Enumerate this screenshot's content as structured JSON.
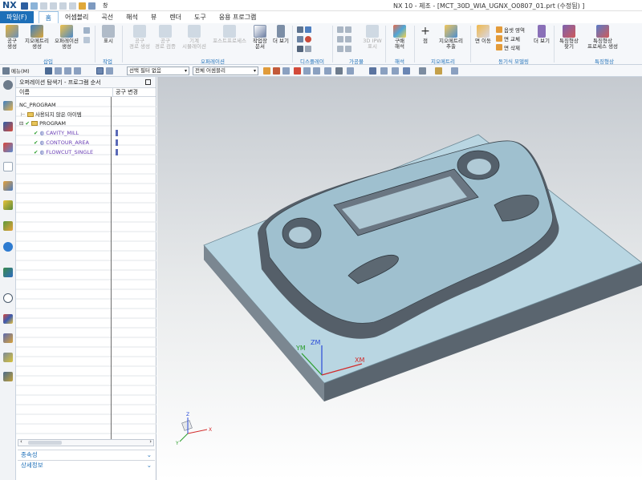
{
  "titlebar": {
    "logo": "NX",
    "title": "NX 10 - 제조 - [MCT_30D_WIA_UGNX_O0807_01.prt (수정됨) ]",
    "window_menu": "창"
  },
  "menubar": {
    "file": "파일(F)",
    "items": [
      "홈",
      "어셈블리",
      "곡선",
      "해석",
      "뷰",
      "렌더",
      "도구",
      "응용 프로그램"
    ],
    "active_index": 0
  },
  "ribbon": {
    "buttons": {
      "tool_create": "공구\n생성",
      "geometry_create": "지오메트리\n생성",
      "operation_create": "오퍼레이션\n생성",
      "display": "표시",
      "toolpath_create": "공구\n경로 생성",
      "toolpath_verify": "공구\n경로 검증",
      "machine_sim": "기계\n시뮬레이션",
      "postprocess": "포스트프로세스",
      "shop_doc": "작업장\n문서",
      "more1": "더 보기",
      "fea3d": "3D IPW\n표시",
      "measure": "구배\n해석",
      "point": "점",
      "geo_extract": "지오메트리\n추출",
      "face_move": "면 이동",
      "offset_area": "옵셋 영역",
      "face_replace": "면 교체",
      "face_delete": "면 삭제",
      "more2": "더 보기",
      "feature_find": "특징형상\n찾기",
      "feature_process": "특징형상\n프로세스 생성"
    },
    "groups": [
      "삽입",
      "작업",
      "오퍼레이션",
      "디스플레이",
      "가공물",
      "해석",
      "지오메트리",
      "동기식 모델링",
      "특징형상"
    ]
  },
  "toolbar2": {
    "menu_label": "메뉴(M)",
    "filter_value": "선택 필터 없음",
    "assembly_value": "전체 어셈블리"
  },
  "navigator": {
    "title": "오퍼레이션 탐색기 - 프로그램 순서",
    "col_name": "이름",
    "col_toolchange": "공구 변경",
    "rows": [
      {
        "label": "NC_PROGRAM",
        "level": 0,
        "type": "root"
      },
      {
        "label": "사용되지 않은 아이템",
        "level": 1,
        "type": "folder"
      },
      {
        "label": "PROGRAM",
        "level": 1,
        "type": "program"
      },
      {
        "label": "CAVITY_MILL",
        "level": 2,
        "type": "op"
      },
      {
        "label": "CONTOUR_AREA",
        "level": 2,
        "type": "op"
      },
      {
        "label": "FLOWCUT_SINGLE",
        "level": 2,
        "type": "op"
      }
    ],
    "accordions": [
      "종속성",
      "상세정보"
    ]
  },
  "viewport": {
    "wcs_labels": {
      "zm": "ZM",
      "ym": "YM",
      "xm": "XM"
    },
    "triad_labels": {
      "x": "X",
      "y": "Y",
      "z": "Z"
    }
  },
  "colors": {
    "accent": "#1d6fb8",
    "part_face": "#b9d6e2",
    "part_side": "#5f6a74",
    "op_text": "#6a3fb5",
    "check": "#2a9d2a"
  }
}
